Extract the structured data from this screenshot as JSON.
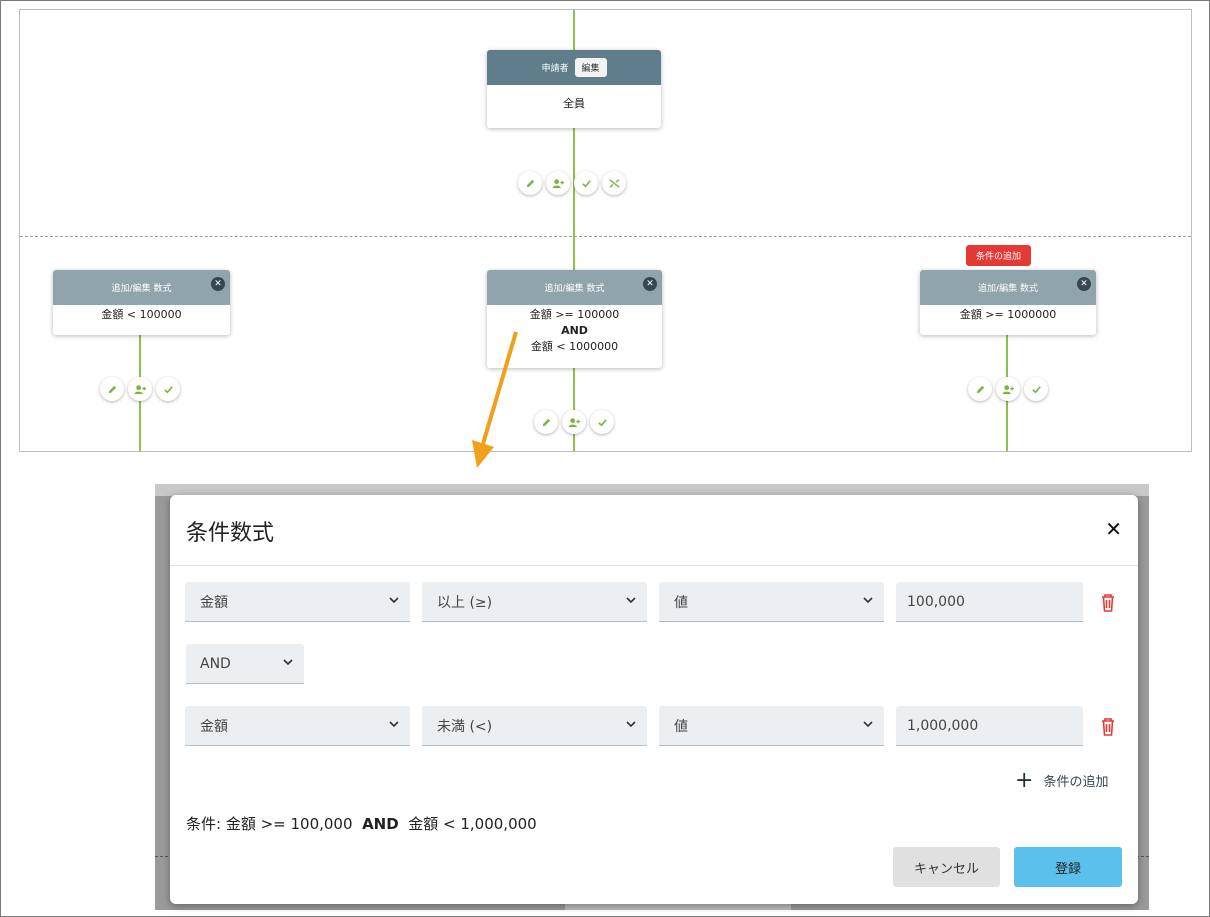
{
  "workflow": {
    "applicant_node": {
      "title": "申請者",
      "edit_label": "編集",
      "body": "全員"
    },
    "branch_nodes": [
      {
        "title": "追加/編集 数式",
        "lines": [
          "金額 < 100000"
        ]
      },
      {
        "title": "追加/編集 数式",
        "lines": [
          "金額 >= 100000",
          "AND",
          "金額 < 1000000"
        ]
      },
      {
        "title": "追加/編集 数式",
        "lines": [
          "金額 >= 1000000"
        ]
      }
    ],
    "add_condition_badge": "条件の追加",
    "close_symbol": "✕",
    "icons": [
      "pencil-icon",
      "add-user-icon",
      "check-icon",
      "shuffle-icon"
    ]
  },
  "dialog": {
    "title": "条件数式",
    "close_symbol": "✕",
    "rows": [
      {
        "field": "金額",
        "operator": "以上 (≥)",
        "value_type": "値",
        "value": "100,000"
      },
      {
        "field": "金額",
        "operator": "未満 (<)",
        "value_type": "値",
        "value": "1,000,000"
      }
    ],
    "logic_operator": "AND",
    "add_condition_label": "条件の追加",
    "add_symbol": "+",
    "summary": {
      "prefix": "条件: 金額 >= 100,000",
      "op": "AND",
      "suffix": "金額 < 1,000,000"
    },
    "cancel_label": "キャンセル",
    "save_label": "登録"
  },
  "colors": {
    "accent_green": "#8bc34a",
    "header_dark": "#607d8b",
    "header_light": "#90a4ae",
    "danger": "#e53935",
    "primary": "#5bc0eb",
    "arrow": "#f0a01c"
  }
}
